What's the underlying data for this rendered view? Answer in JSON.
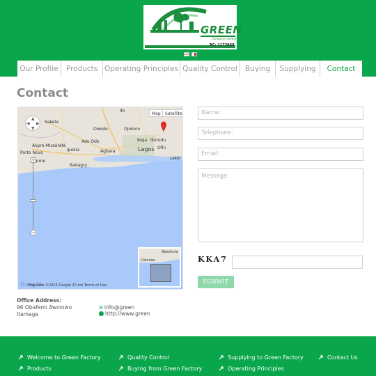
{
  "header": {
    "logo": {
      "brand": "GREEN",
      "subtitle": "Company Limited",
      "rc": "RC: 1173969"
    },
    "flags": [
      "uk-flag-icon",
      "language-flag-icon"
    ]
  },
  "nav": {
    "items": [
      {
        "label": "Our Profile",
        "w": 63
      },
      {
        "label": "Products",
        "w": 60
      },
      {
        "label": "Operating Principles",
        "w": 111
      },
      {
        "label": "Quality Control",
        "w": 86
      },
      {
        "label": "Buying",
        "w": 51
      },
      {
        "label": "Supplying",
        "w": 64
      },
      {
        "label": "Contact",
        "w": 60,
        "active": true
      }
    ]
  },
  "page_title": "Contact",
  "map": {
    "buttons": [
      "Map",
      "Satellite"
    ],
    "labels": [
      "Ifo",
      "Sakete",
      "Owode",
      "Ojokoro",
      "Ikorodu",
      "Ado Odo",
      "Ikeja",
      "Akpro-Missérété",
      "Ipokia",
      "Porto Novo",
      "Agbara",
      "Lagos",
      "Ofin",
      "Lekki",
      "Seme",
      "Badagry",
      "Cotonou",
      "Abeokuta"
    ],
    "footer": "Map data ©2015 Google   20 km        Terms of Use",
    "google": "Google"
  },
  "form": {
    "name_placeholder": "Name:",
    "telephone_placeholder": "Telephone:",
    "email_placeholder": "Email:",
    "message_placeholder": "Message:",
    "captcha": "KKA7",
    "submit_label": "SUBMIT"
  },
  "office": {
    "heading": "Office Address:",
    "line1": "96 Obafemi Awolowo",
    "line2": "Itamaga",
    "email": "info@green",
    "website": "http://www.green"
  },
  "footer": {
    "links": [
      {
        "label": "Welcome to Green Factory"
      },
      {
        "label": "Products"
      },
      {
        "label": "Quality Control"
      },
      {
        "label": "Buying from Green Factory"
      },
      {
        "label": "Supplying to Green Factory"
      },
      {
        "label": "Operating Principles"
      },
      {
        "label": "Contact Us"
      }
    ]
  },
  "colors": {
    "brand_green": "#0aa64b",
    "submit_green": "#8fd8ac",
    "map_water": "#a9c9fb",
    "map_land": "#e8e4dc"
  }
}
